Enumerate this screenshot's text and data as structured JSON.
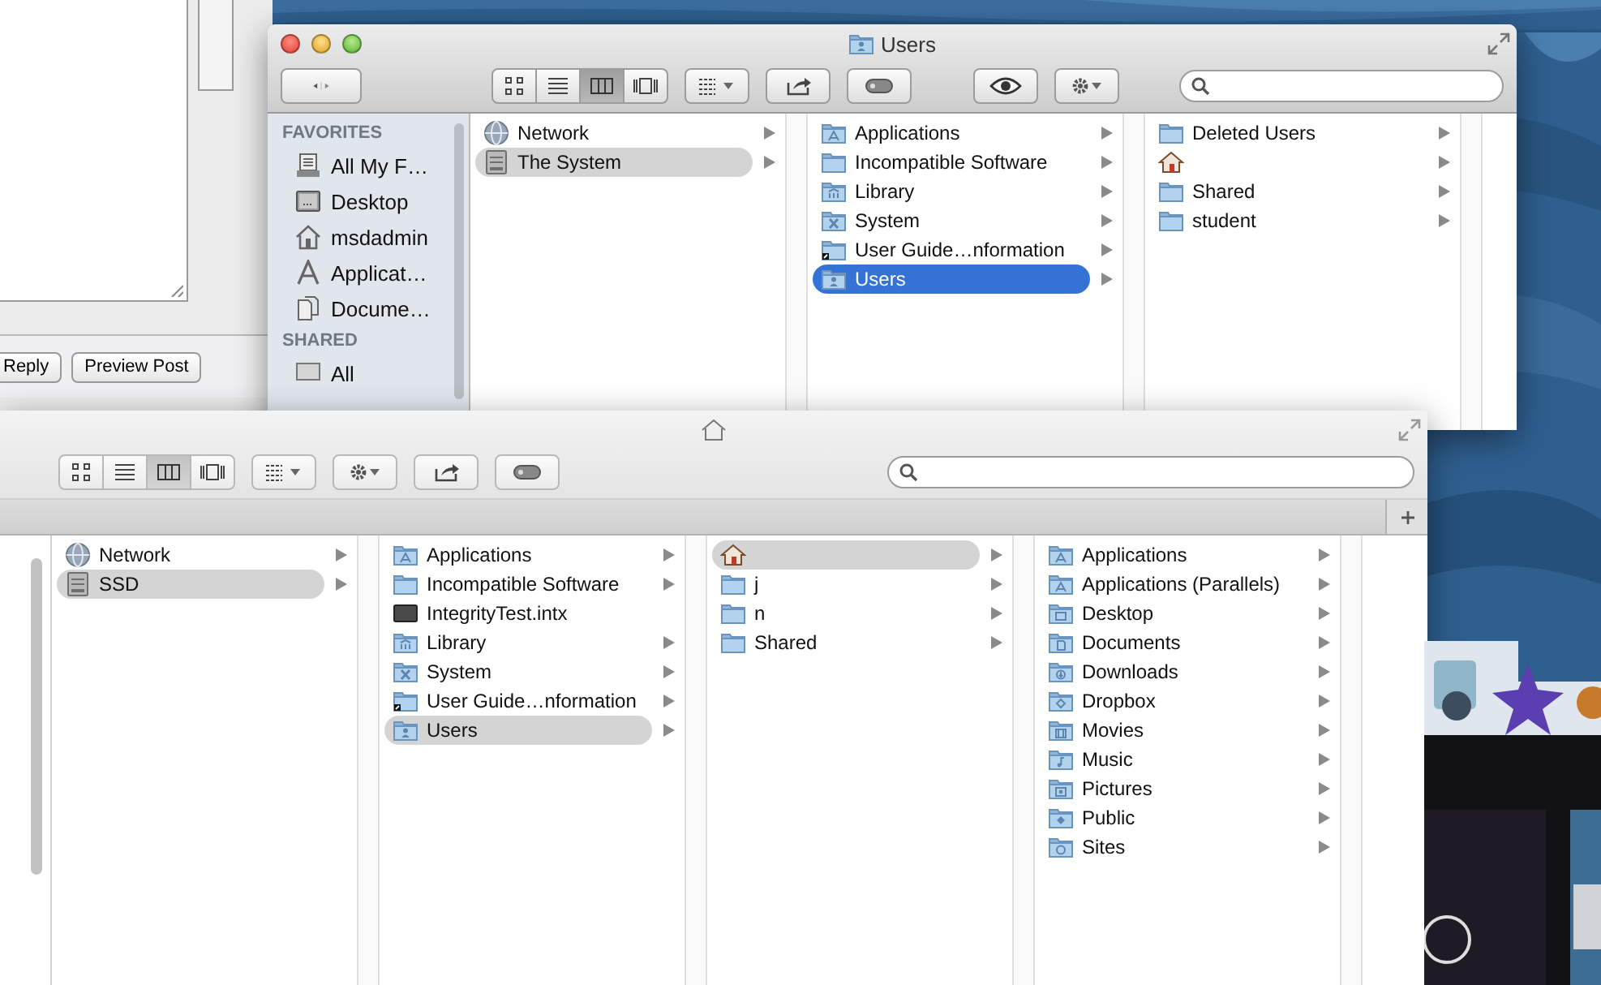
{
  "browser_window": {
    "buttons": [
      "Reply",
      "Preview Post"
    ]
  },
  "back_window": {
    "title": "Users",
    "toolbar": [
      {
        "kind": "nav"
      },
      {
        "kind": "view",
        "modes": [
          {
            "kind": "icons",
            "selected": false
          },
          {
            "kind": "list",
            "selected": false
          },
          {
            "kind": "columns",
            "selected": true
          },
          {
            "kind": "coverflow",
            "selected": false
          }
        ]
      },
      {
        "kind": "arrange"
      },
      {
        "kind": "share"
      },
      {
        "kind": "tags"
      },
      {
        "kind": "quicklook"
      },
      {
        "kind": "action"
      },
      {
        "kind": "search"
      }
    ],
    "sidebar": [
      {
        "heading": "FAVORITES",
        "items": [
          {
            "label": "All My F…",
            "kind": "all-files"
          },
          {
            "label": "Desktop",
            "kind": "desktop"
          },
          {
            "label": "msdadmin",
            "kind": "home"
          },
          {
            "label": "Applicat…",
            "kind": "applications"
          },
          {
            "label": "Docume…",
            "kind": "documents"
          }
        ]
      },
      {
        "heading": "SHARED",
        "items": [
          {
            "label": "All",
            "kind": "computer"
          }
        ]
      }
    ],
    "columns": [
      {
        "focused": false,
        "items": [
          {
            "label": "Network",
            "kind": "globe",
            "selected": false
          },
          {
            "label": "The System",
            "kind": "disk",
            "selected": true
          }
        ]
      },
      {
        "focused": true,
        "items": [
          {
            "label": "Applications",
            "kind": "apps",
            "selected": false
          },
          {
            "label": "Incompatible Software",
            "kind": "folder",
            "selected": false
          },
          {
            "label": "Library",
            "kind": "library",
            "selected": false
          },
          {
            "label": "System",
            "kind": "system",
            "selected": false
          },
          {
            "label": "User Guide…nformation",
            "kind": "alias",
            "selected": false
          },
          {
            "label": "Users",
            "kind": "users",
            "selected": true
          }
        ]
      },
      {
        "items": [
          {
            "label": "Deleted Users",
            "kind": "folder",
            "selected": false
          },
          {
            "kind": "home",
            "selected": false
          },
          {
            "label": "Shared",
            "kind": "folder",
            "selected": false
          },
          {
            "label": "student",
            "kind": "folder",
            "selected": false
          }
        ]
      }
    ]
  },
  "front_window": {
    "toolbar": [
      {
        "kind": "view",
        "modes": [
          {
            "kind": "icons",
            "selected": false
          },
          {
            "kind": "list",
            "selected": false
          },
          {
            "kind": "columns",
            "selected": true
          },
          {
            "kind": "coverflow",
            "selected": false
          }
        ]
      },
      {
        "kind": "arrange"
      },
      {
        "kind": "action"
      },
      {
        "kind": "share"
      },
      {
        "kind": "tags"
      },
      {
        "kind": "search"
      }
    ],
    "columns": [
      {
        "focused": false,
        "items": [
          {
            "label": "Network",
            "kind": "globe",
            "selected": false
          },
          {
            "label": "SSD",
            "kind": "disk",
            "selected": true
          }
        ]
      },
      {
        "focused": false,
        "items": [
          {
            "label": "Applications",
            "kind": "apps",
            "selected": false
          },
          {
            "label": "Incompatible Software",
            "kind": "folder",
            "selected": false
          },
          {
            "label": "IntegrityTest.intx",
            "kind": "file",
            "selected": false
          },
          {
            "label": "Library",
            "kind": "library",
            "selected": false
          },
          {
            "label": "System",
            "kind": "system",
            "selected": false
          },
          {
            "label": "User Guide…nformation",
            "kind": "alias",
            "selected": false
          },
          {
            "label": "Users",
            "kind": "users",
            "selected": true
          }
        ]
      },
      {
        "focused": false,
        "items": [
          {
            "kind": "home",
            "selected": true
          },
          {
            "label": "j",
            "kind": "folder",
            "selected": false
          },
          {
            "label": "n",
            "kind": "folder",
            "selected": false
          },
          {
            "label": "Shared",
            "kind": "folder",
            "selected": false
          }
        ]
      },
      {
        "items": [
          {
            "label": "Applications",
            "kind": "apps",
            "selected": false
          },
          {
            "label": "Applications (Parallels)",
            "kind": "apps",
            "selected": false
          },
          {
            "label": "Desktop",
            "kind": "desktop-folder",
            "selected": false
          },
          {
            "label": "Documents",
            "kind": "documents-folder",
            "selected": false
          },
          {
            "label": "Downloads",
            "kind": "downloads",
            "selected": false
          },
          {
            "label": "Dropbox",
            "kind": "dropbox",
            "selected": false
          },
          {
            "label": "Movies",
            "kind": "movies",
            "selected": false
          },
          {
            "label": "Music",
            "kind": "music",
            "selected": false
          },
          {
            "label": "Pictures",
            "kind": "pictures",
            "selected": false
          },
          {
            "label": "Public",
            "kind": "public",
            "selected": false
          },
          {
            "label": "Sites",
            "kind": "sites",
            "selected": false
          }
        ]
      }
    ]
  }
}
